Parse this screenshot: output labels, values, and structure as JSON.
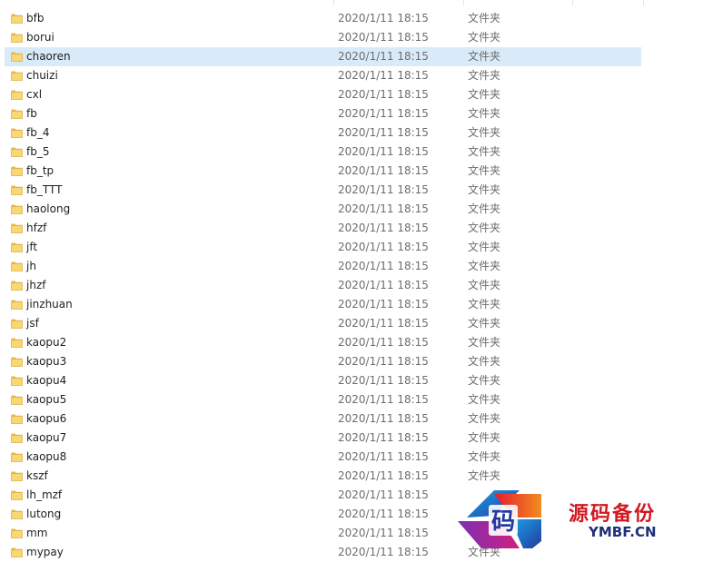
{
  "explorer": {
    "files": [
      {
        "name": "bfb",
        "modified": "2020/1/11 18:15",
        "type": "文件夹"
      },
      {
        "name": "borui",
        "modified": "2020/1/11 18:15",
        "type": "文件夹"
      },
      {
        "name": "chaoren",
        "modified": "2020/1/11 18:15",
        "type": "文件夹",
        "selected": true
      },
      {
        "name": "chuizi",
        "modified": "2020/1/11 18:15",
        "type": "文件夹"
      },
      {
        "name": "cxl",
        "modified": "2020/1/11 18:15",
        "type": "文件夹"
      },
      {
        "name": "fb",
        "modified": "2020/1/11 18:15",
        "type": "文件夹"
      },
      {
        "name": "fb_4",
        "modified": "2020/1/11 18:15",
        "type": "文件夹"
      },
      {
        "name": "fb_5",
        "modified": "2020/1/11 18:15",
        "type": "文件夹"
      },
      {
        "name": "fb_tp",
        "modified": "2020/1/11 18:15",
        "type": "文件夹"
      },
      {
        "name": "fb_TTT",
        "modified": "2020/1/11 18:15",
        "type": "文件夹"
      },
      {
        "name": "haolong",
        "modified": "2020/1/11 18:15",
        "type": "文件夹"
      },
      {
        "name": "hfzf",
        "modified": "2020/1/11 18:15",
        "type": "文件夹"
      },
      {
        "name": "jft",
        "modified": "2020/1/11 18:15",
        "type": "文件夹"
      },
      {
        "name": "jh",
        "modified": "2020/1/11 18:15",
        "type": "文件夹"
      },
      {
        "name": "jhzf",
        "modified": "2020/1/11 18:15",
        "type": "文件夹"
      },
      {
        "name": "jinzhuan",
        "modified": "2020/1/11 18:15",
        "type": "文件夹"
      },
      {
        "name": "jsf",
        "modified": "2020/1/11 18:15",
        "type": "文件夹"
      },
      {
        "name": "kaopu2",
        "modified": "2020/1/11 18:15",
        "type": "文件夹"
      },
      {
        "name": "kaopu3",
        "modified": "2020/1/11 18:15",
        "type": "文件夹"
      },
      {
        "name": "kaopu4",
        "modified": "2020/1/11 18:15",
        "type": "文件夹"
      },
      {
        "name": "kaopu5",
        "modified": "2020/1/11 18:15",
        "type": "文件夹"
      },
      {
        "name": "kaopu6",
        "modified": "2020/1/11 18:15",
        "type": "文件夹"
      },
      {
        "name": "kaopu7",
        "modified": "2020/1/11 18:15",
        "type": "文件夹"
      },
      {
        "name": "kaopu8",
        "modified": "2020/1/11 18:15",
        "type": "文件夹"
      },
      {
        "name": "kszf",
        "modified": "2020/1/11 18:15",
        "type": "文件夹"
      },
      {
        "name": "lh_mzf",
        "modified": "2020/1/11 18:15",
        "type": ""
      },
      {
        "name": "lutong",
        "modified": "2020/1/11 18:15",
        "type": ""
      },
      {
        "name": "mm",
        "modified": "2020/1/11 18:15",
        "type": ""
      },
      {
        "name": "mypay",
        "modified": "2020/1/11 18:15",
        "type": "文件夹"
      }
    ]
  },
  "icons": {
    "folder": "folder-icon"
  },
  "colors": {
    "folder_fill": "#f8d775",
    "folder_tab": "#e9b949",
    "selection": "#d9ebf9",
    "watermark_red": "#d1181f",
    "watermark_blue": "#1e2e7a"
  },
  "watermark": {
    "logo_char": "码",
    "title": "源码备份",
    "subtitle": "YMBF.CN"
  }
}
